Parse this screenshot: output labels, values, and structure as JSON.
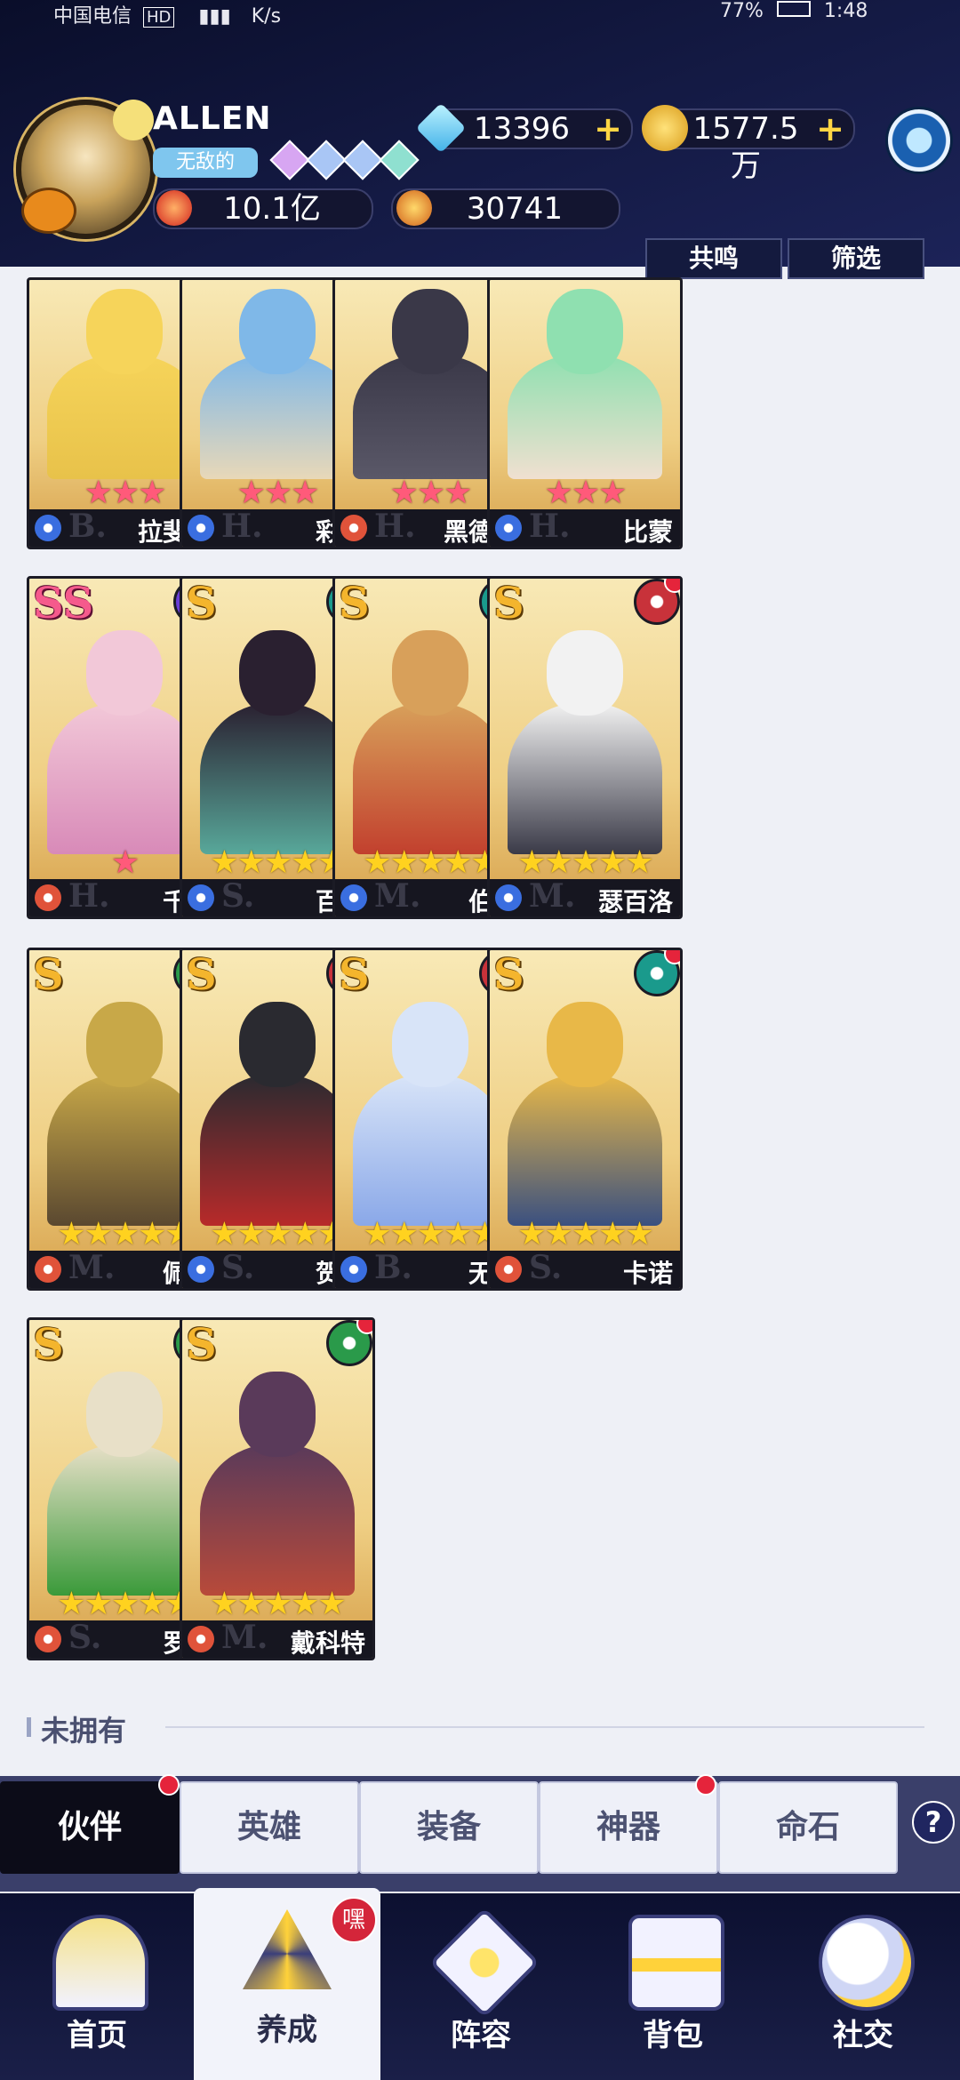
{
  "status_bar": {
    "carrier": "中国电信",
    "hd": "HD",
    "speed": "K/s",
    "battery": "77%",
    "time": "1:48"
  },
  "player": {
    "name": "ALLEN",
    "title": "无敌的"
  },
  "currencies": [
    {
      "icon": "diamond-icon",
      "value": "13396"
    },
    {
      "icon": "gold-coin-icon",
      "value": "1577.5万"
    },
    {
      "icon": "power-flame-icon",
      "value": "10.1亿"
    },
    {
      "icon": "star-energy-icon",
      "value": "30741"
    }
  ],
  "top_buttons": {
    "resonance": "共鸣",
    "filter": "筛选"
  },
  "heroes": [
    {
      "name": "拉斐尔",
      "rank": "",
      "stars": 3,
      "star_color": "pink",
      "tier": "B.",
      "faction_color": "#ffffff",
      "class_color": "#3a6ee0",
      "alert": false
    },
    {
      "name": "彩练",
      "rank": "",
      "stars": 3,
      "star_color": "pink",
      "tier": "H.",
      "faction_color": "#ffffff",
      "class_color": "#3a6ee0",
      "alert": false
    },
    {
      "name": "黑德斯",
      "rank": "",
      "stars": 3,
      "star_color": "pink",
      "tier": "H.",
      "faction_color": "#ffffff",
      "class_color": "#e0533a",
      "alert": false
    },
    {
      "name": "比蒙",
      "rank": "",
      "stars": 3,
      "star_color": "pink",
      "tier": "H.",
      "faction_color": "#ffffff",
      "class_color": "#3a6ee0",
      "alert": false
    },
    {
      "name": "千夏",
      "rank": "SS",
      "stars": 1,
      "star_color": "pink",
      "tier": "H.",
      "faction_color": "#6a3ed6",
      "class_color": "#e0533a",
      "alert": false
    },
    {
      "name": "百特",
      "rank": "S",
      "stars": 5,
      "star_color": "gold",
      "tier": "S.",
      "faction_color": "#1a9a8c",
      "class_color": "#3a6ee0",
      "alert": true
    },
    {
      "name": "伯恩",
      "rank": "S",
      "stars": 5,
      "star_color": "gold",
      "tier": "M.",
      "faction_color": "#1a9a8c",
      "class_color": "#3a6ee0",
      "alert": true
    },
    {
      "name": "瑟百洛",
      "rank": "S",
      "stars": 5,
      "star_color": "gold",
      "tier": "M.",
      "faction_color": "#c8323a",
      "class_color": "#3a6ee0",
      "alert": true
    },
    {
      "name": "佩凯",
      "rank": "S",
      "stars": 5,
      "star_color": "gold",
      "tier": "M.",
      "faction_color": "#2a9a4a",
      "class_color": "#e0533a",
      "alert": true
    },
    {
      "name": "贺茂",
      "rank": "S",
      "stars": 5,
      "star_color": "gold",
      "tier": "S.",
      "faction_color": "#c8323a",
      "class_color": "#3a6ee0",
      "alert": true
    },
    {
      "name": "无玉",
      "rank": "S",
      "stars": 5,
      "star_color": "gold",
      "tier": "B.",
      "faction_color": "#c8323a",
      "class_color": "#3a6ee0",
      "alert": true
    },
    {
      "name": "卡诺",
      "rank": "S",
      "stars": 5,
      "star_color": "gold",
      "tier": "S.",
      "faction_color": "#1a9a8c",
      "class_color": "#e0533a",
      "alert": true
    },
    {
      "name": "罗宾",
      "rank": "S",
      "stars": 5,
      "star_color": "gold",
      "tier": "S.",
      "faction_color": "#2a9a4a",
      "class_color": "#e0533a",
      "alert": true
    },
    {
      "name": "戴科特",
      "rank": "S",
      "stars": 5,
      "star_color": "gold",
      "tier": "M.",
      "faction_color": "#2a9a4a",
      "class_color": "#e0533a",
      "alert": true
    }
  ],
  "section": {
    "not_owned": "未拥有"
  },
  "sub_tabs": [
    "伙伴",
    "英雄",
    "装备",
    "神器",
    "命石"
  ],
  "help": "?",
  "bottom_nav": [
    {
      "label": "首页",
      "icon": "home-icon"
    },
    {
      "label": "养成",
      "icon": "develop-icon",
      "badge": "嘿"
    },
    {
      "label": "阵容",
      "icon": "formation-icon"
    },
    {
      "label": "背包",
      "icon": "backpack-icon"
    },
    {
      "label": "社交",
      "icon": "social-icon"
    }
  ]
}
